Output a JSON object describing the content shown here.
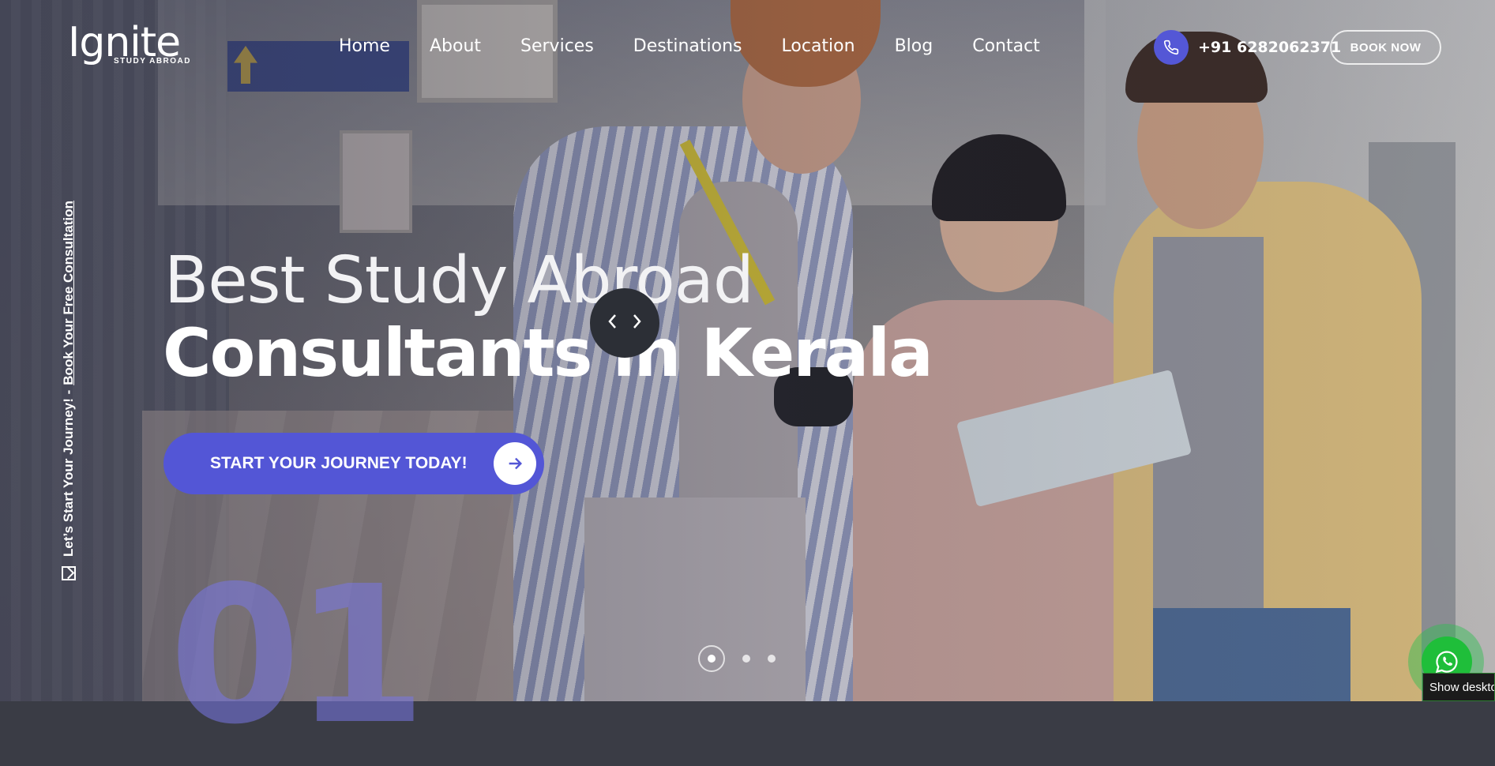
{
  "brand": {
    "name": "Ignite",
    "tagline": "STUDY ABROAD"
  },
  "nav": {
    "items": [
      {
        "label": "Home"
      },
      {
        "label": "About"
      },
      {
        "label": "Services"
      },
      {
        "label": "Destinations"
      },
      {
        "label": "Location"
      },
      {
        "label": "Blog"
      },
      {
        "label": "Contact"
      }
    ]
  },
  "contact": {
    "phone": "+91 6282062371",
    "icon": "phone-icon"
  },
  "header_cta": {
    "label": "BOOK NOW"
  },
  "side": {
    "text": "Let’s Start Your Journey! -",
    "link": "Book Your Free Consultation",
    "icon": "mail-icon"
  },
  "hero": {
    "line1": "Best Study Abroad",
    "line2": "Consultants in Kerala",
    "cta_label": "START YOUR JOURNEY TODAY!",
    "slide_number": "01"
  },
  "slider": {
    "total": 3,
    "active_index": 1
  },
  "whatsapp": {
    "tooltip": "Show deskto"
  },
  "colors": {
    "accent": "#5356d6",
    "whatsapp": "#1fbe3a"
  }
}
